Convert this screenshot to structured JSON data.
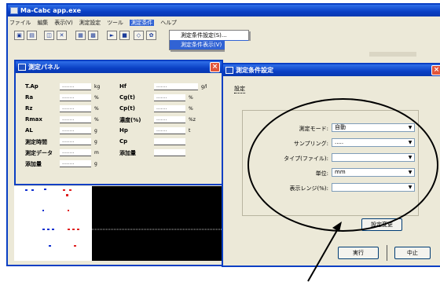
{
  "main_window": {
    "title": "Ma-Cabc app.exe",
    "menu": [
      "ファイル",
      "編集",
      "表示(V)",
      "測定設定",
      "ツール",
      "測定条件",
      "ヘルプ"
    ],
    "highlighted_menu": "測定条件",
    "toolbar_icons": [
      "open-icon",
      "save-icon",
      "print-icon",
      "copy-icon",
      "paste-icon",
      "start-icon",
      "stop-icon",
      "setting-icon"
    ]
  },
  "dropdown": {
    "items": [
      "測定条件設定(S)...",
      "測定条件表示(V)"
    ],
    "selected_index": 1
  },
  "measure_panel": {
    "title": "測定パネル",
    "rows": [
      {
        "label": "T.Ap",
        "value": "........",
        "unit": "kg",
        "label2": "Hf",
        "value2": ".......",
        "unit2": "g/l"
      },
      {
        "label": "Ra",
        "value": "........",
        "unit": "%",
        "label2": "Cg(t)",
        "value2": ".......",
        "unit2": "%"
      },
      {
        "label": "Rz",
        "value": "........",
        "unit": "%",
        "label2": "Cp(t)",
        "value2": ".......",
        "unit2": "%"
      },
      {
        "label": "Rmax",
        "value": "........",
        "unit": "%",
        "label2": "濃度(%)",
        "value2": ".......",
        "unit2": "%z"
      },
      {
        "label": "AL",
        "value": "........",
        "unit": "g",
        "label2": "Hp",
        "value2": ".......",
        "unit2": "t"
      },
      {
        "label": "測定時間",
        "value": "........",
        "unit": "g",
        "label2": "Cp",
        "value2": "",
        "unit2": ""
      },
      {
        "label": "測定データ",
        "value": "........",
        "unit": "m",
        "label2": "添加量",
        "value2": "",
        "unit2": ""
      },
      {
        "label": "添加量",
        "value": "........",
        "unit": "g",
        "label2": "",
        "value2": "",
        "unit2": ""
      }
    ]
  },
  "dialog": {
    "title": "測定条件設定",
    "tab": "設定",
    "fields": [
      {
        "label": "測定モード:",
        "value": "自動"
      },
      {
        "label": "サンプリング:",
        "value": "....."
      },
      {
        "label": "タイプ(ファイル):",
        "value": ""
      },
      {
        "label": "単位:",
        "value": "mm"
      },
      {
        "label": "表示レンジ(%):",
        "value": ""
      }
    ],
    "apply_button": "設定変更",
    "ok_button": "実行",
    "cancel_button": "中止"
  },
  "colors": {
    "title_blue": "#0a3fc4",
    "window_face": "#ece9d8",
    "chart_bg": "#000000",
    "red_marker": "#e02020",
    "blue_marker": "#1030d0"
  }
}
